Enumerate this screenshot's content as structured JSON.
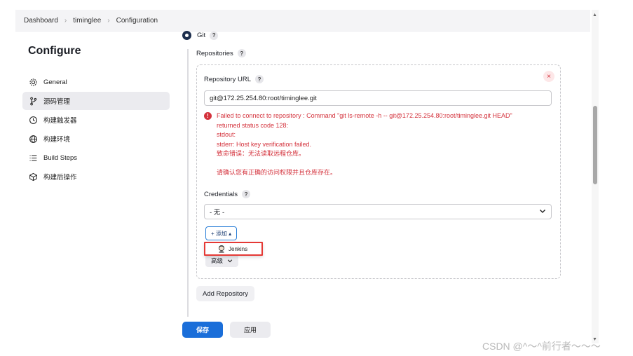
{
  "breadcrumb": [
    "Dashboard",
    "timinglee",
    "Configuration"
  ],
  "page_title": "Configure",
  "sidebar": {
    "items": [
      {
        "label": "General",
        "icon": "gear-icon",
        "active": false
      },
      {
        "label": "源码管理",
        "icon": "git-branch-icon",
        "active": true
      },
      {
        "label": "构建触发器",
        "icon": "clock-icon",
        "active": false
      },
      {
        "label": "构建环境",
        "icon": "globe-icon",
        "active": false
      },
      {
        "label": "Build Steps",
        "icon": "list-icon",
        "active": false
      },
      {
        "label": "构建后操作",
        "icon": "package-icon",
        "active": false
      }
    ]
  },
  "scm": {
    "git_label": "Git",
    "help_symbol": "?",
    "repositories_label": "Repositories",
    "repo_url_label": "Repository URL",
    "repo_url_value": "git@172.25.254.80:root/timinglee.git",
    "remove_symbol": "×",
    "error_icon_symbol": "!",
    "error_lines": [
      "Failed to connect to repository : Command \"git ls-remote -h -- git@172.25.254.80:root/timinglee.git HEAD\"",
      "returned status code 128:",
      "stdout:",
      "stderr: Host key verification failed.",
      "致命错误：无法读取远程仓库。",
      "",
      "请确认您有正确的访问权限并且仓库存在。"
    ],
    "credentials_label": "Credentials",
    "credentials_value": "- 无 -",
    "add_button_label": "+ 添加 ▴",
    "dropdown_item": "Jenkins",
    "advanced_label": "高级",
    "add_repository_label": "Add Repository"
  },
  "footer": {
    "save_label": "保存",
    "apply_label": "应用"
  },
  "watermark": "CSDN @^～^前行者～～～",
  "colors": {
    "primary": "#1a6ed9",
    "error": "#d4323c",
    "highlight_border": "#e53935",
    "radio": "#1c2e4d"
  }
}
